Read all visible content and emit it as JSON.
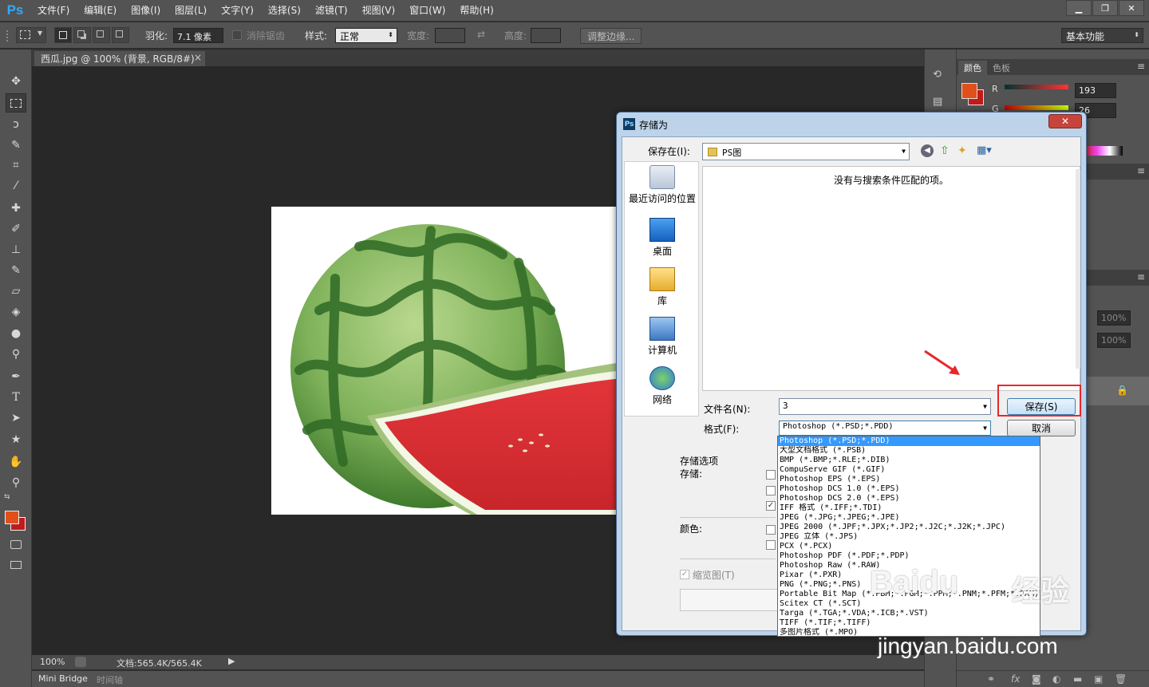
{
  "app": {
    "logo": "Ps"
  },
  "menu": [
    "文件(F)",
    "编辑(E)",
    "图像(I)",
    "图层(L)",
    "文字(Y)",
    "选择(S)",
    "滤镜(T)",
    "视图(V)",
    "窗口(W)",
    "帮助(H)"
  ],
  "options": {
    "feather_label": "羽化:",
    "feather_value": "7.1 像素",
    "antialias_label": "消除锯齿",
    "style_label": "样式:",
    "style_value": "正常",
    "width_label": "宽度:",
    "height_label": "高度:",
    "refine_edge": "调整边缘...",
    "workspace": "基本功能"
  },
  "document": {
    "tab_title": "西瓜.jpg @ 100% (背景, RGB/8#) *",
    "tab_close": "×"
  },
  "status": {
    "zoom": "100%",
    "doc_info": "文档:565.4K/565.4K"
  },
  "bottom_tabs": [
    "Mini Bridge",
    "时间轴"
  ],
  "panels": {
    "color_tabs": [
      "颜色",
      "色板"
    ],
    "r_label": "R",
    "r_value": "193",
    "g_label": "G",
    "g_value": "26",
    "opacity_1": "100%",
    "opacity_2": "100%"
  },
  "dialog": {
    "title": "存储为",
    "close": "✕",
    "save_in_label": "保存在(I):",
    "save_in_value": "PS图",
    "places": [
      "最近访问的位置",
      "桌面",
      "库",
      "计算机",
      "网络"
    ],
    "empty_message": "没有与搜索条件匹配的项。",
    "filename_label": "文件名(N):",
    "filename_value": "3",
    "format_label": "格式(F):",
    "format_value": "Photoshop (*.PSD;*.PDD)",
    "save_button": "保存(S)",
    "cancel_button": "取消",
    "save_options_title": "存储选项",
    "save_label": "存储:",
    "color_label": "颜色:",
    "thumbnail_label": "缩览图(T)",
    "format_options": [
      "Photoshop (*.PSD;*.PDD)",
      "大型文档格式 (*.PSB)",
      "BMP (*.BMP;*.RLE;*.DIB)",
      "CompuServe GIF (*.GIF)",
      "Photoshop EPS (*.EPS)",
      "Photoshop DCS 1.0 (*.EPS)",
      "Photoshop DCS 2.0 (*.EPS)",
      "IFF 格式 (*.IFF;*.TDI)",
      "JPEG (*.JPG;*.JPEG;*.JPE)",
      "JPEG 2000 (*.JPF;*.JPX;*.JP2;*.J2C;*.J2K;*.JPC)",
      "JPEG 立体 (*.JPS)",
      "PCX (*.PCX)",
      "Photoshop PDF (*.PDF;*.PDP)",
      "Photoshop Raw (*.RAW)",
      "Pixar (*.PXR)",
      "PNG (*.PNG;*.PNS)",
      "Portable Bit Map (*.PBM;*.PGM;*.PPM;*.PNM;*.PFM;*.PAM)",
      "Scitex CT (*.SCT)",
      "Targa (*.TGA;*.VDA;*.ICB;*.VST)",
      "TIFF (*.TIF;*.TIFF)",
      "多图片格式 (*.MPO)"
    ]
  },
  "watermark": {
    "brand": "Baidu",
    "brand_cn": "经验",
    "url": "jingyan.baidu.com"
  },
  "colors": {
    "foreground": "#e0501a",
    "background": "#c11a1a",
    "accent_blue": "#31a8ff",
    "highlight_red": "#e8272f"
  }
}
